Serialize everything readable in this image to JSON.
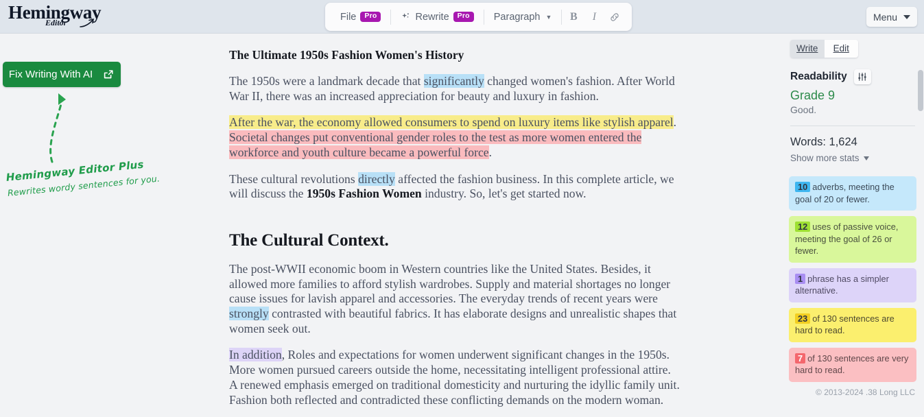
{
  "app": {
    "logo_main": "Hemingway",
    "logo_sub": "Editor"
  },
  "toolbar": {
    "file_label": "File",
    "file_badge": "Pro",
    "rewrite_label": "Rewrite",
    "rewrite_badge": "Pro",
    "paragraph_label": "Paragraph",
    "bold_label": "B",
    "italic_label": "I",
    "menu_label": "Menu",
    "icons": {
      "sparkle": "sparkle-icon",
      "link": "link-icon",
      "chevron": "chevron-down-icon"
    }
  },
  "sidebar_left": {
    "cta_label": "Fix Writing With AI",
    "cta_icon": "external-link-icon",
    "promo_line1": "Hemingway Editor Plus",
    "promo_line2": "Rewrites wordy sentences for you.",
    "accent_color": "#1a8a3f"
  },
  "document": {
    "title": "The Ultimate 1950s Fashion Women's History",
    "paragraph1": {
      "a": "The 1950s were a landmark decade that ",
      "adverb": "significantly",
      "b": " changed women's fashion. After World War II, there was an increased appreciation for beauty and luxury in fashion."
    },
    "paragraph2": {
      "hard": "After the war, the economy allowed consumers to spend on luxury items like stylish apparel",
      "mid": ". ",
      "veryhard": "Societal changes put conventional gender roles to the test as more women entered the workforce and youth culture became a powerful force",
      "end": "."
    },
    "paragraph3": {
      "a": "These cultural revolutions ",
      "adverb": "directly",
      "b": " affected the fashion business. In this complete article, we will discuss the ",
      "bold": "1950s Fashion Women",
      "c": " industry. So, let's get started now."
    },
    "heading2": "The Cultural Context.",
    "paragraph4": {
      "a": "The post-WWII economic boom in Western countries like the United States. Besides, it allowed more families to afford stylish wardrobes. Supply and material shortages no longer cause issues for lavish apparel and accessories. The everyday trends of recent years were ",
      "adverb": "strongly",
      "b": " contrasted with beautiful fabrics. It has elaborate designs and unrealistic shapes that women seek out."
    },
    "paragraph5": {
      "phrase": "In addition",
      "rest": ", Roles and expectations for women underwent significant changes in the 1950s. More women pursued careers outside the home, necessitating intelligent professional attire. A renewed emphasis emerged on traditional domesticity and nurturing the idyllic family unit. Fashion both reflected and contradicted these conflicting demands on the modern woman."
    }
  },
  "sidebar_right": {
    "tab_write": "Write",
    "tab_edit": "Edit",
    "active_tab": "Write",
    "readability_label": "Readability",
    "sliders_icon": "sliders-icon",
    "grade": "Grade 9",
    "grade_color": "#2c8a4a",
    "quality": "Good.",
    "words": "Words: 1,624",
    "show_more_stats": "Show more stats",
    "cards": [
      {
        "num": "10",
        "text": "adverbs, meeting the goal of 20 or fewer.",
        "color": "c-blue"
      },
      {
        "num": "12",
        "text": "uses of passive voice, meeting the goal of 26 or fewer.",
        "color": "c-green"
      },
      {
        "num": "1",
        "text": "phrase has a simpler alternative.",
        "color": "c-purple"
      },
      {
        "num": "23",
        "text": "of 130 sentences are hard to read.",
        "color": "c-yellow"
      },
      {
        "num": "7",
        "text": "of 130 sentences are very hard to read.",
        "color": "c-pink"
      }
    ],
    "copyright": "© 2013-2024 .38 Long LLC"
  }
}
